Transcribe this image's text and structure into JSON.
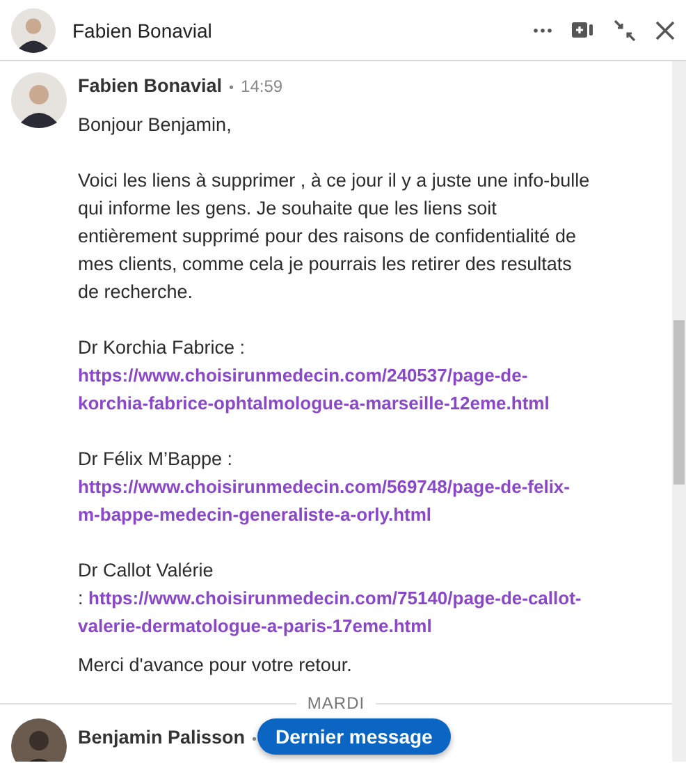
{
  "header": {
    "name": "Fabien Bonavial"
  },
  "messages": [
    {
      "sender": "Fabien Bonavial",
      "bullet": "•",
      "time": "14:59",
      "blocks": [
        {
          "kind": "text",
          "text": "Bonjour Benjamin,"
        },
        {
          "kind": "text",
          "text": "Voici les liens à supprimer , à ce jour il y a juste une info-bulle qui informe les gens.  Je souhaite que les liens soit entièrement supprimé pour des raisons de confidentialité de mes clients, comme cela je pourrais les retirer des resultats de recherche."
        },
        {
          "kind": "contact",
          "label": "Dr Korchia Fabrice :",
          "link": "https://www.choisirunmedecin.com/240537/page-de-korchia-fabrice-ophtalmologue-a-marseille-12eme.html"
        },
        {
          "kind": "contact",
          "label": "Dr Félix M’Bappe :",
          "link": "https://www.choisirunmedecin.com/569748/page-de-felix-m-bappe-medecin-generaliste-a-orly.html"
        },
        {
          "kind": "contact",
          "label": "Dr Callot Valérie",
          "prefix": ":",
          "link": "https://www.choisirunmedecin.com/75140/page-de-callot-valerie-dermatologue-a-paris-17eme.html"
        },
        {
          "kind": "closing",
          "text": "Merci d'avance pour votre retour."
        }
      ]
    }
  ],
  "day_divider": "MARDI",
  "next_message": {
    "sender": "Benjamin Palisson",
    "bullet": "•"
  },
  "jump_button": "Dernier message"
}
